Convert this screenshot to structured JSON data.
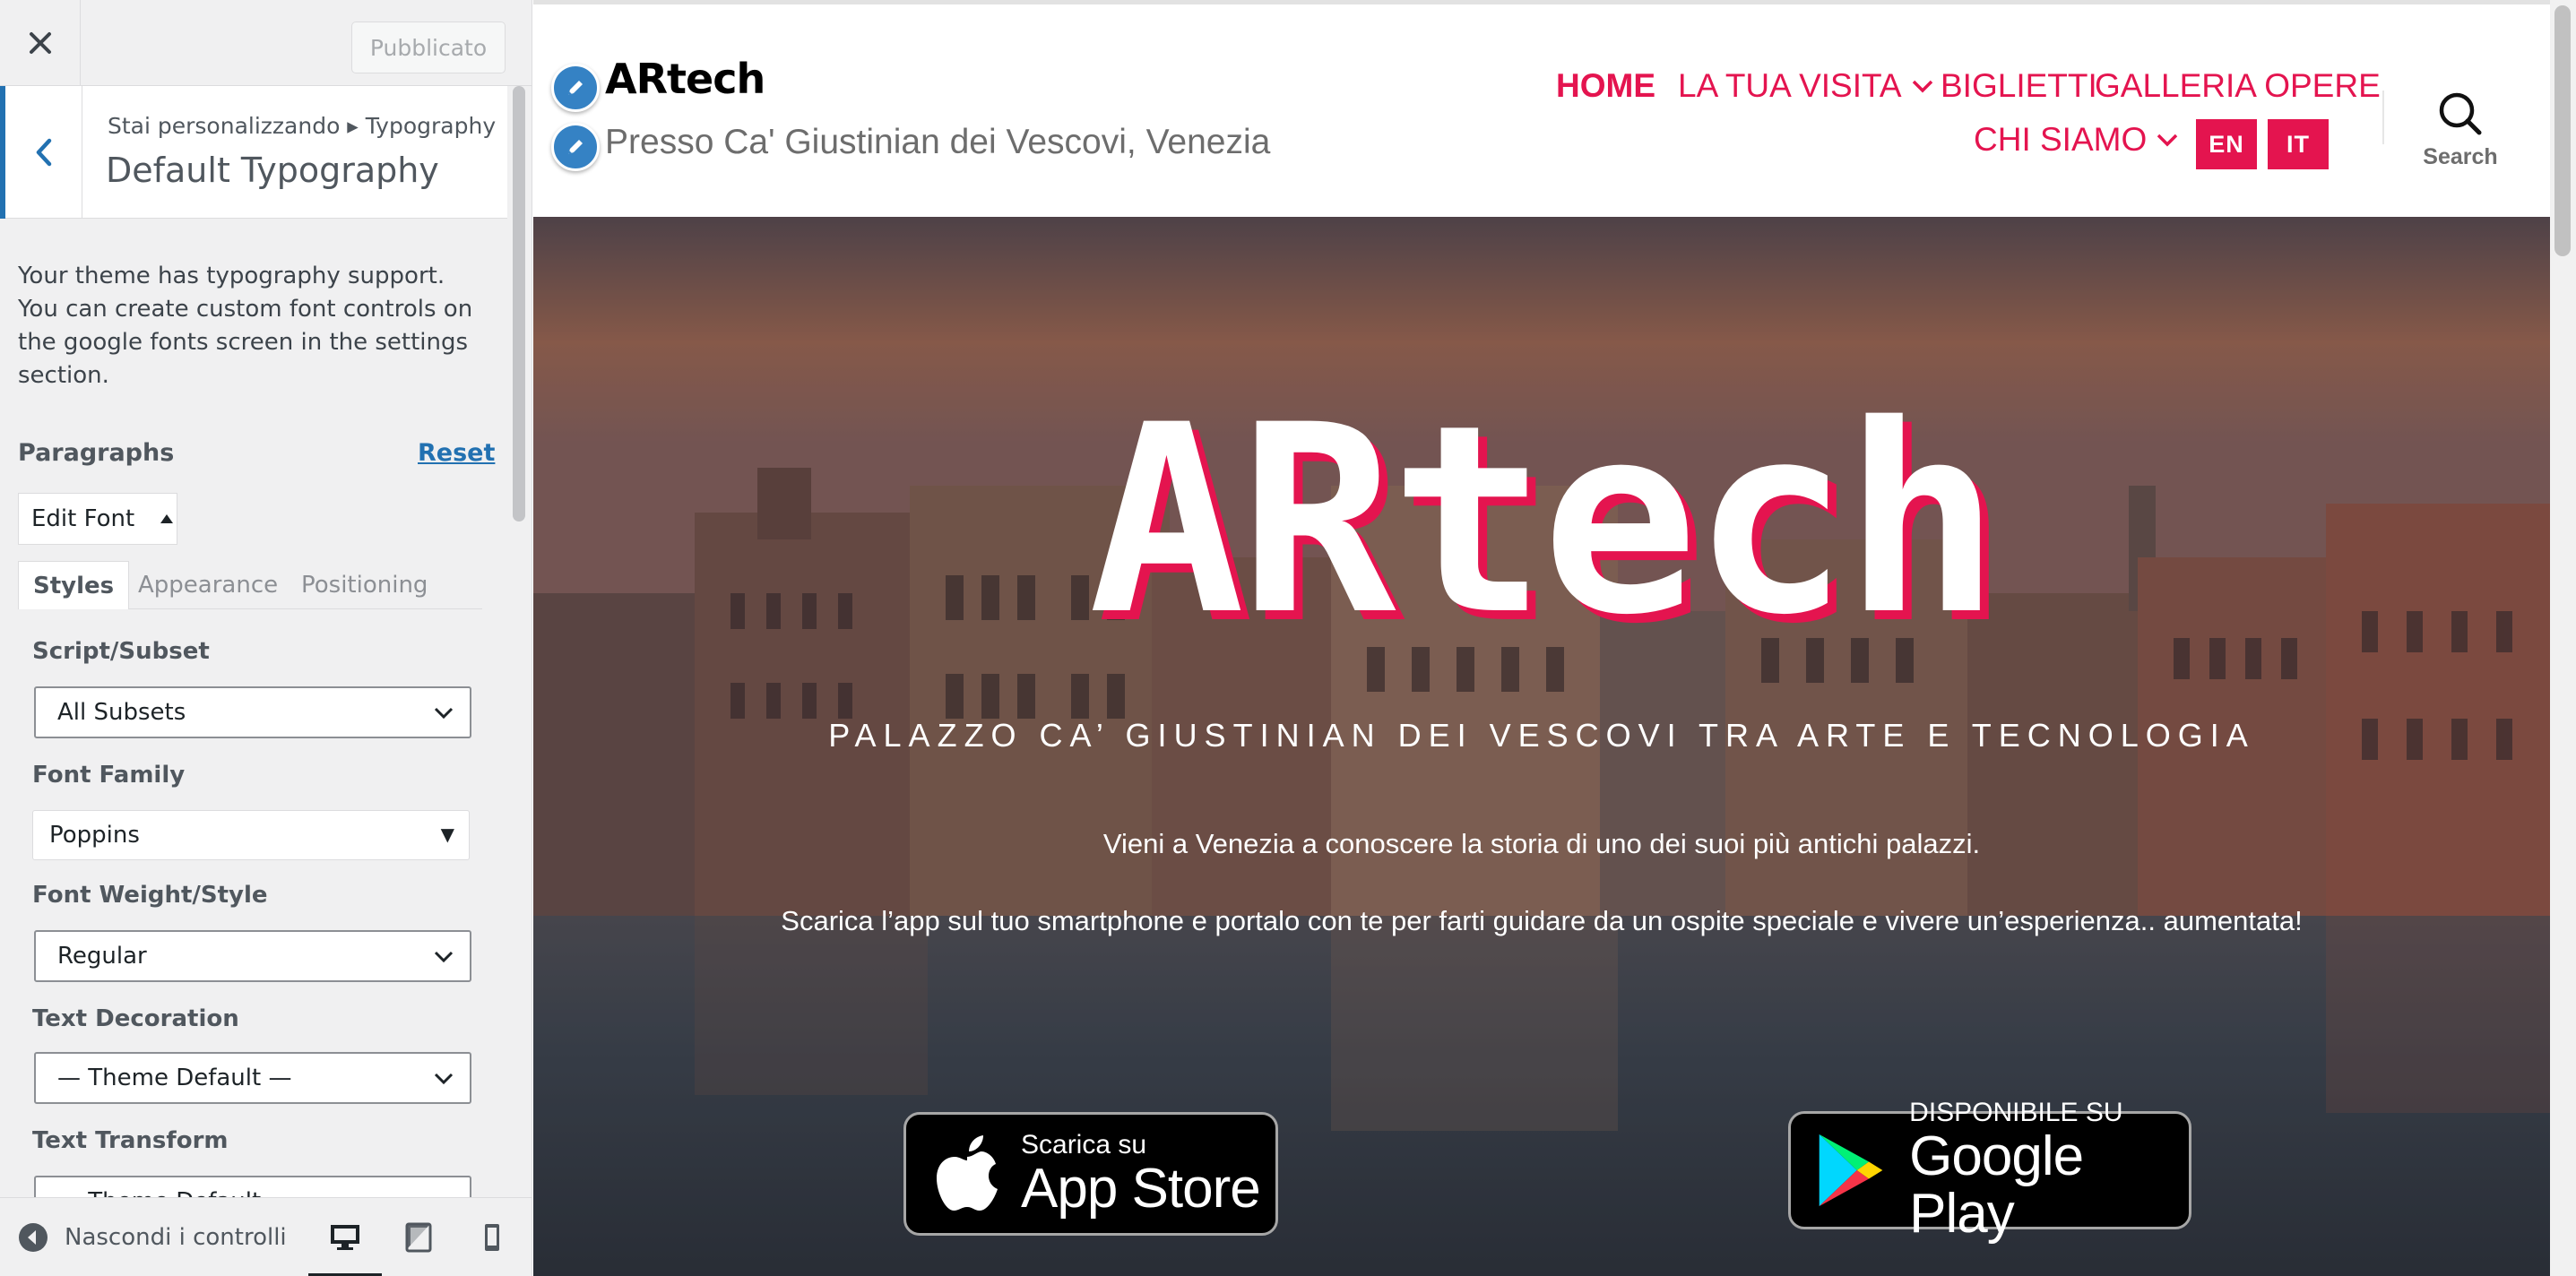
{
  "customizer": {
    "publish_button": "Pubblicato",
    "breadcrumb": "Stai personalizzando ▸ Typography",
    "section_title": "Default Typography",
    "theme_note": "Your theme has typography support. You can create custom font controls on the google fonts screen in the settings section.",
    "paragraphs_label": "Paragraphs",
    "reset_link": "Reset",
    "edit_font_button": "Edit Font",
    "tabs": [
      "Styles",
      "Appearance",
      "Positioning"
    ],
    "fields": {
      "script_subset": {
        "label": "Script/Subset",
        "value": "All Subsets"
      },
      "font_family": {
        "label": "Font Family",
        "value": "Poppins"
      },
      "font_weight": {
        "label": "Font Weight/Style",
        "value": "Regular"
      },
      "text_decoration": {
        "label": "Text Decoration",
        "value": "— Theme Default —"
      },
      "text_transform": {
        "label": "Text Transform",
        "value": "— Theme Default —"
      }
    },
    "footer": {
      "hide_controls": "Nascondi i controlli"
    }
  },
  "site": {
    "title": "ARtech",
    "tagline": "Presso Ca' Giustinian dei Vescovi, Venezia",
    "nav": {
      "home": "HOME",
      "visita": "LA TUA VISITA",
      "biglietti": "BIGLIETTI",
      "galleria": "GALLERIA OPERE",
      "chi_siamo": "CHI SIAMO"
    },
    "lang": {
      "en": "EN",
      "it": "IT"
    },
    "search_label": "Search",
    "accent_color": "#e4144f"
  },
  "hero": {
    "title": "ARtech",
    "subtitle": "PALAZZO CA’ GIUSTINIAN DEI VESCOVI TRA ARTE E TECNOLOGIA",
    "text_1": "Vieni a Venezia a conoscere la storia di uno dei suoi più antichi palazzi.",
    "text_2": "Scarica l’app sul tuo smartphone e portalo con te per farti guidare da un ospite speciale e vivere un’esperienza.. aumentata!",
    "appstore": {
      "small": "Scarica su",
      "big": "App Store"
    },
    "googleplay": {
      "small": "DISPONIBILE SU",
      "big": "Google Play"
    }
  }
}
